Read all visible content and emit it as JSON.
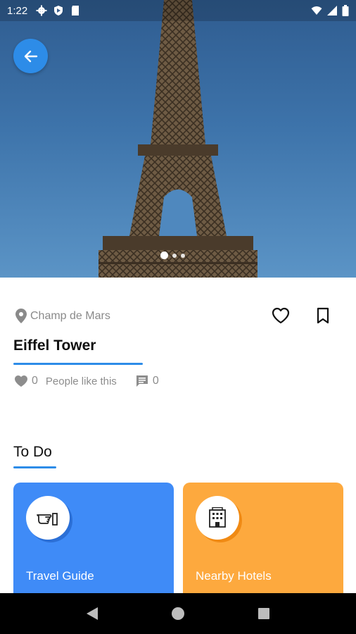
{
  "statusbar": {
    "time": "1:22"
  },
  "place": {
    "location": "Champ de Mars",
    "name": "Eiffel Tower",
    "likes_count": "0",
    "likes_label": "People like this",
    "comments_count": "0"
  },
  "carousel": {
    "active_index": 0,
    "count": 3
  },
  "todo": {
    "title": "To Do",
    "cards": [
      {
        "label": "Travel Guide",
        "icon": "pointing-hand-icon",
        "color": "#3f8bf7"
      },
      {
        "label": "Nearby Hotels",
        "icon": "hotel-building-icon",
        "color": "#fda93e"
      }
    ]
  },
  "colors": {
    "accent": "#2d8ce8"
  }
}
